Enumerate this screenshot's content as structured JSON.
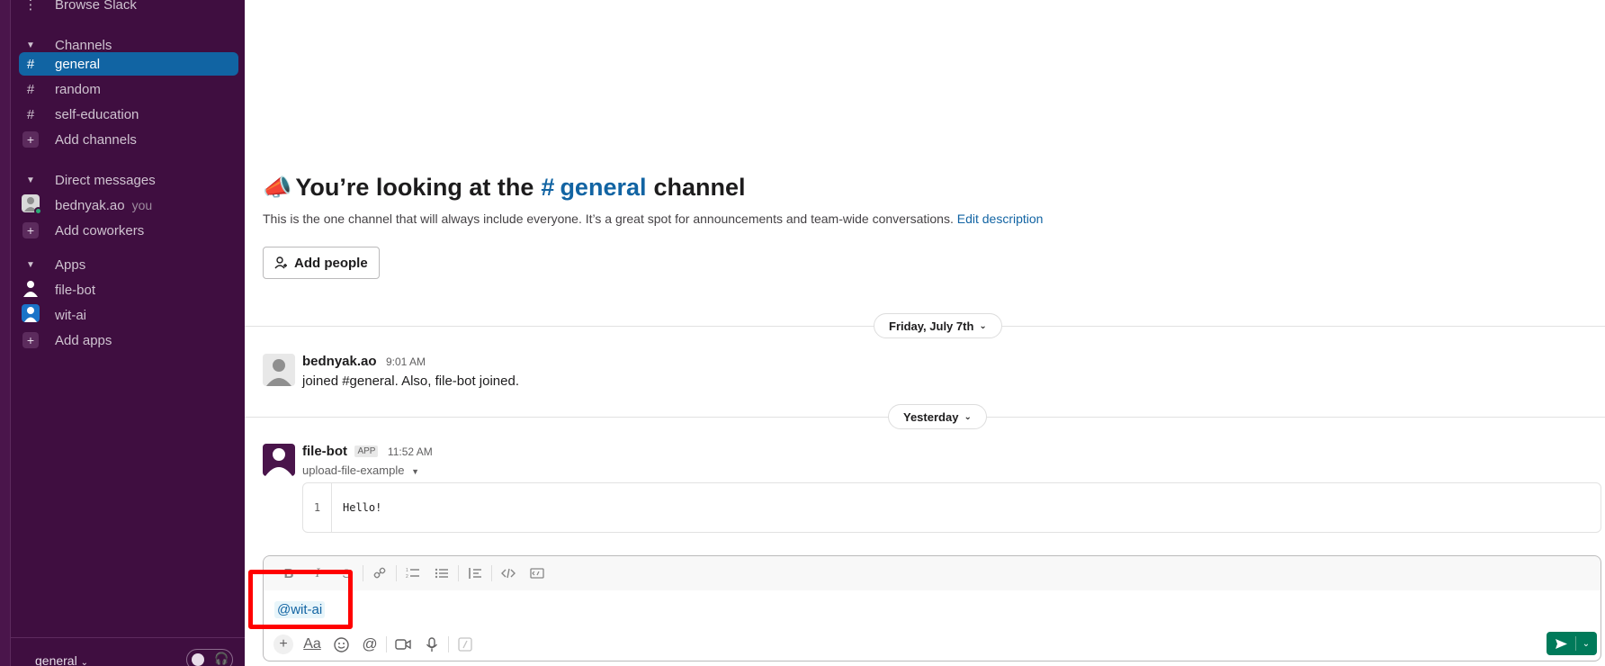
{
  "sidebar": {
    "browse_label": "Browse Slack",
    "channels_header": "Channels",
    "channels": [
      {
        "name": "general",
        "active": true
      },
      {
        "name": "random",
        "active": false
      },
      {
        "name": "self-education",
        "active": false
      }
    ],
    "add_channels": "Add channels",
    "dm_header": "Direct messages",
    "dm_user": "bednyak.ao",
    "dm_you": "you",
    "add_coworkers": "Add coworkers",
    "apps_header": "Apps",
    "apps": [
      "file-bot",
      "wit-ai"
    ],
    "add_apps": "Add apps",
    "footer_workspace": "general"
  },
  "intro": {
    "title_prefix": "You’re looking at the",
    "hash": "#",
    "channel": "general",
    "title_suffix": "channel",
    "description": "This is the one channel that will always include everyone. It’s a great spot for announcements and team-wide conversations.",
    "edit_link": "Edit description",
    "add_people": "Add people"
  },
  "dividers": {
    "first": "Friday, July 7th",
    "second": "Yesterday"
  },
  "messages": [
    {
      "author": "bednyak.ao",
      "time": "9:01 AM",
      "text": "joined #general. Also, file-bot joined."
    },
    {
      "author": "file-bot",
      "badge": "APP",
      "time": "11:52 AM",
      "subtitle": "upload-file-example",
      "code_line_number": "1",
      "code": "Hello!"
    }
  ],
  "composer": {
    "text": "@wit-ai",
    "toolbar": [
      "B",
      "I",
      "S",
      "link",
      "ordered-list",
      "bulleted-list",
      "blockquote",
      "code",
      "code-block"
    ]
  },
  "colors": {
    "sidebar_bg": "#3f0e40",
    "active_channel": "#1164a3",
    "link": "#1264a3",
    "send_button": "#007a5a",
    "annotation_box": "#ff0000"
  }
}
